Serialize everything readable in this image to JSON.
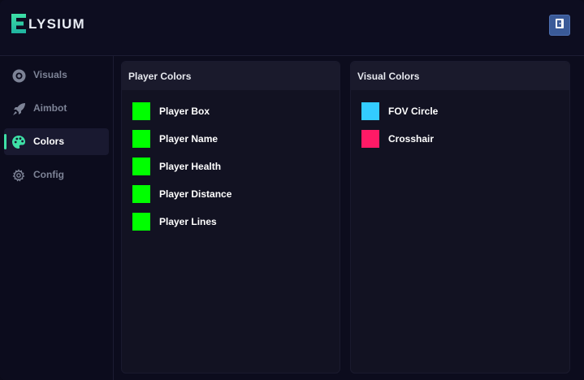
{
  "app": {
    "brand_text": "LYSIUM",
    "accent": "#3ee0a6"
  },
  "sidebar": {
    "items": [
      {
        "label": "Visuals",
        "icon": "eye-ring-icon",
        "active": false
      },
      {
        "label": "Aimbot",
        "icon": "rocket-icon",
        "active": false
      },
      {
        "label": "Colors",
        "icon": "palette-icon",
        "active": true
      },
      {
        "label": "Config",
        "icon": "gear-icon",
        "active": false
      }
    ]
  },
  "panels": {
    "player": {
      "title": "Player Colors",
      "items": [
        {
          "label": "Player Box",
          "color": "#00ff00"
        },
        {
          "label": "Player Name",
          "color": "#00ff00"
        },
        {
          "label": "Player Health",
          "color": "#00ff00"
        },
        {
          "label": "Player Distance",
          "color": "#00ff00"
        },
        {
          "label": "Player Lines",
          "color": "#00ff00"
        }
      ]
    },
    "visual": {
      "title": "Visual Colors",
      "items": [
        {
          "label": "FOV Circle",
          "color": "#33ccff"
        },
        {
          "label": "Crosshair",
          "color": "#ff1a66"
        }
      ]
    }
  }
}
